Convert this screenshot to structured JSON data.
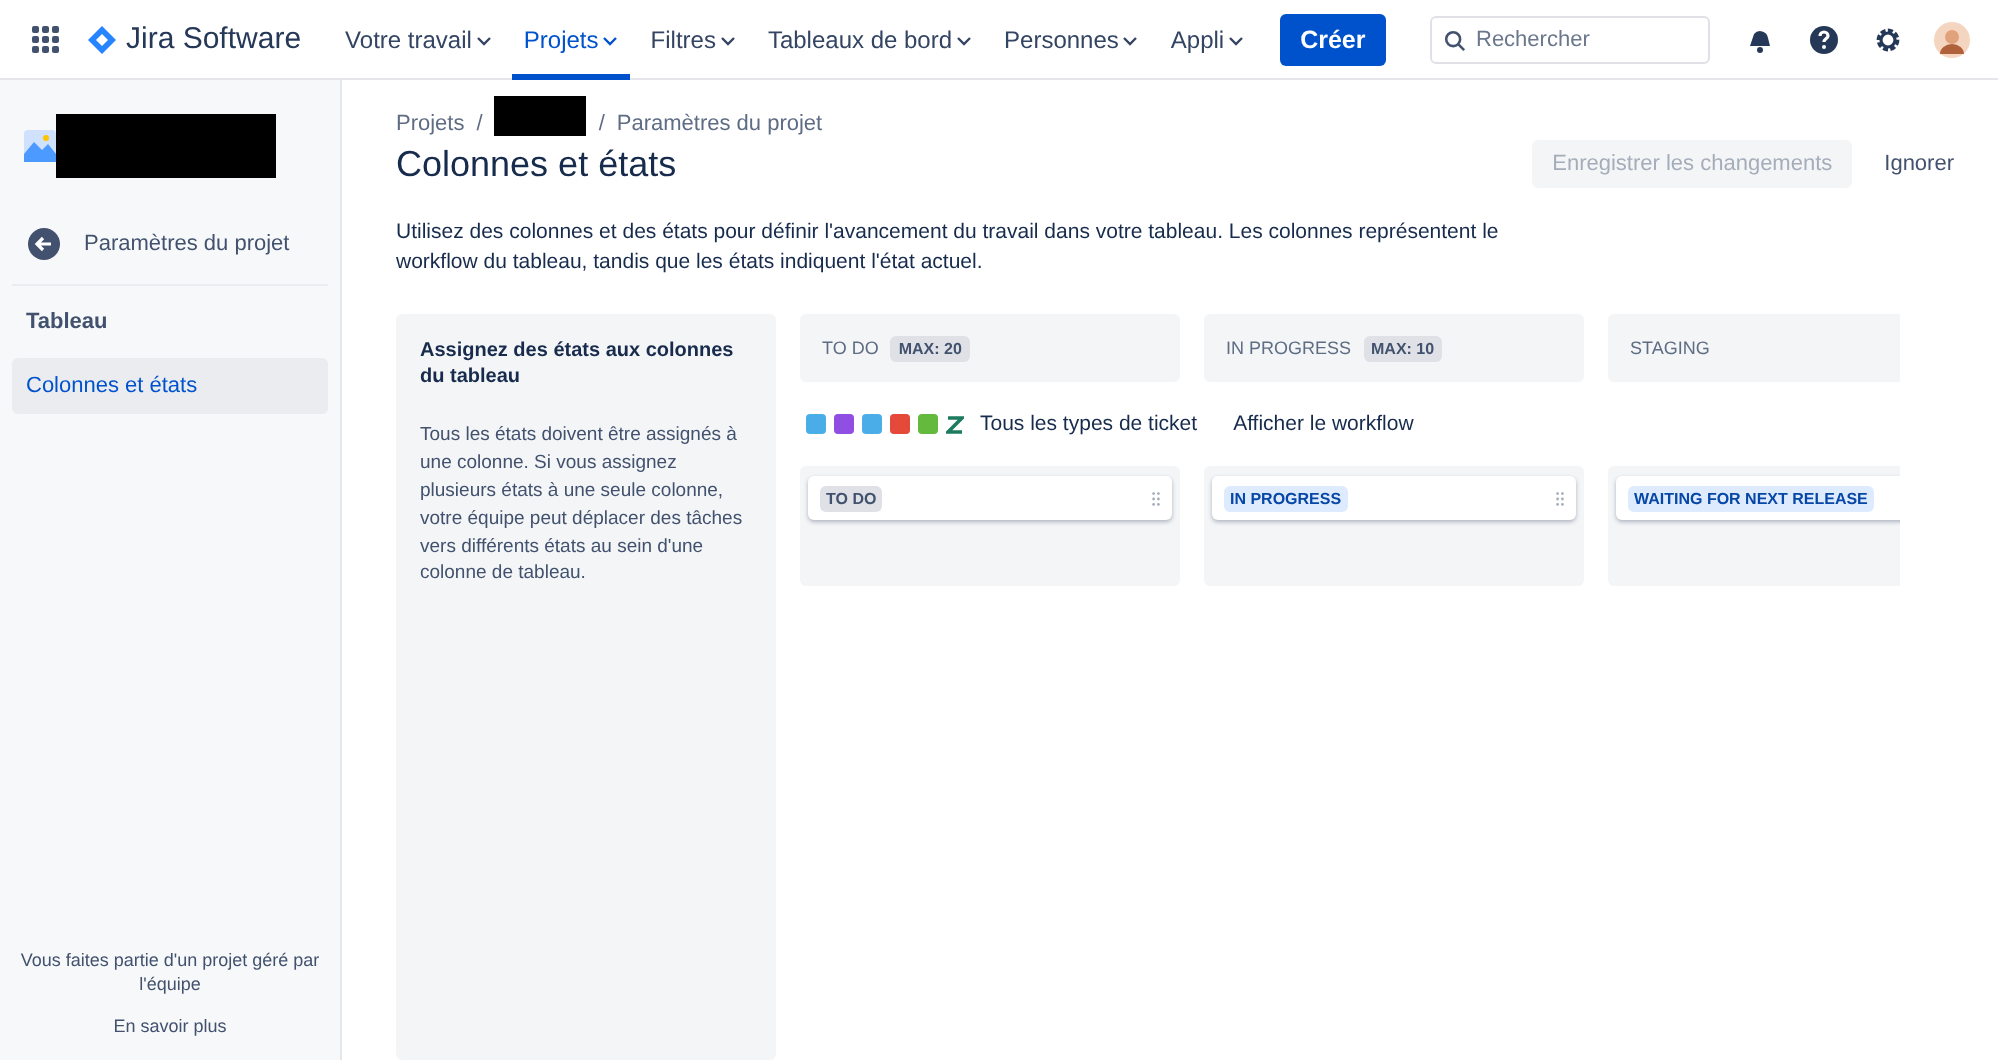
{
  "top_nav": {
    "product": "Jira Software",
    "menus": [
      {
        "label": "Votre travail",
        "selected": false
      },
      {
        "label": "Projets",
        "selected": true
      },
      {
        "label": "Filtres",
        "selected": false
      },
      {
        "label": "Tableaux de bord",
        "selected": false
      },
      {
        "label": "Personnes",
        "selected": false
      },
      {
        "label": "Appli",
        "selected": false
      }
    ],
    "create_button": "Créer",
    "search": {
      "placeholder": "Rechercher"
    }
  },
  "sidebar": {
    "back_link": "Paramètres du projet",
    "section": "Tableau",
    "items": [
      {
        "label": "Colonnes et états",
        "selected": true
      }
    ],
    "footer_text": "Vous faites partie d'un projet géré par l'équipe",
    "footer_link": "En savoir plus"
  },
  "breadcrumbs": [
    "Projets",
    "Paramètres du projet"
  ],
  "breadcrumb_separators": [
    "/",
    "/"
  ],
  "page_title": "Colonnes et états",
  "actions": {
    "save": {
      "label": "Enregistrer les changements",
      "disabled": true
    },
    "discard": "Ignorer"
  },
  "description": "Utilisez des colonnes et des états pour définir l'avancement du travail dans votre tableau. Les colonnes représentent le workflow du tableau, tandis que les états indiquent l'état actuel.",
  "help_panel": {
    "title": "Assignez des états aux colonnes du tableau",
    "body": "Tous les états doivent être assignés à une colonne. Si vous assignez plusieurs états à une seule colonne, votre équipe peut déplacer des tâches vers différents états au sein d'une colonne de tableau."
  },
  "issue_types": [
    {
      "color": "#4bade8"
    },
    {
      "color": "#904ee2"
    },
    {
      "color": "#4bade8"
    },
    {
      "color": "#e5493a"
    },
    {
      "color": "#63ba3c"
    }
  ],
  "issue_filter": "Tous les types de ticket",
  "workflow_link": "Afficher le workflow",
  "columns": [
    {
      "name": "TO DO",
      "limit": "MAX: 20",
      "statuses": [
        {
          "label": "TO DO",
          "kind": "todo"
        }
      ]
    },
    {
      "name": "IN PROGRESS",
      "limit": "MAX: 10",
      "statuses": [
        {
          "label": "IN PROGRESS",
          "kind": "progress"
        }
      ]
    },
    {
      "name": "STAGING",
      "statuses": [
        {
          "label": "WAITING FOR NEXT RELEASE",
          "kind": "progress"
        }
      ]
    }
  ]
}
